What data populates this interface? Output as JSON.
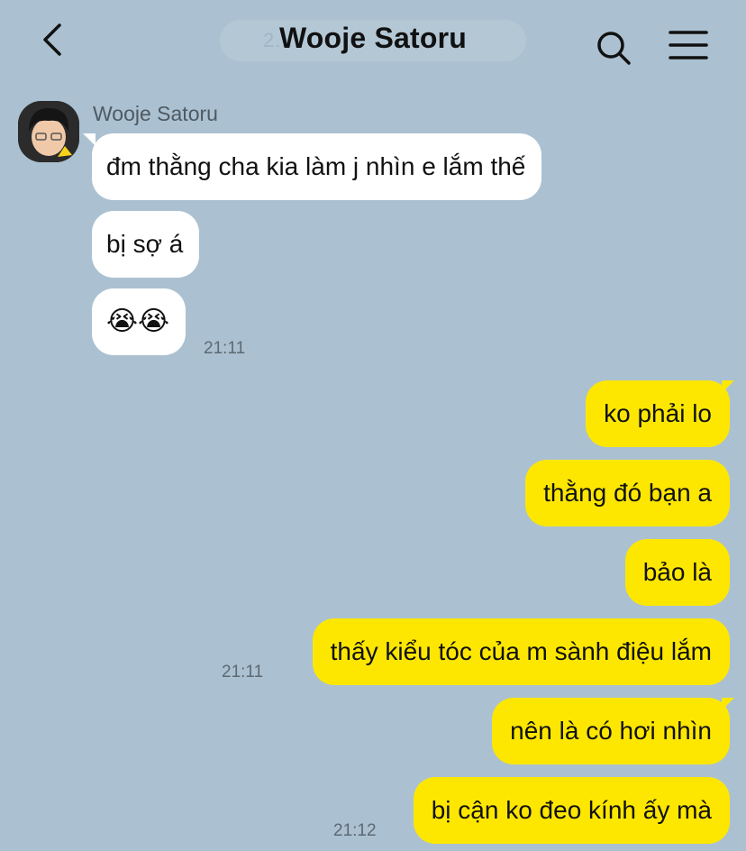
{
  "header": {
    "title": "Wooje Satoru",
    "date_pill": "2…"
  },
  "contact": {
    "name": "Wooje Satoru"
  },
  "messages_in": [
    {
      "text": "đm thằng cha kia làm j nhìn e lắm thế"
    },
    {
      "text": "bị sợ á"
    },
    {
      "text": "😭😭",
      "time": "21:11"
    }
  ],
  "messages_out": [
    {
      "text": "ko phải lo"
    },
    {
      "text": "thằng đó bạn a"
    },
    {
      "text": "bảo là"
    },
    {
      "text": "thấy kiểu tóc của m sành điệu lắm",
      "time": "21:11"
    },
    {
      "text": "nên là có hơi nhìn"
    },
    {
      "text": "bị cận ko đeo kính ấy mà",
      "time": "21:12"
    }
  ],
  "colors": {
    "background": "#abc1d1",
    "outgoing_bubble": "#fde700",
    "incoming_bubble": "#ffffff"
  }
}
